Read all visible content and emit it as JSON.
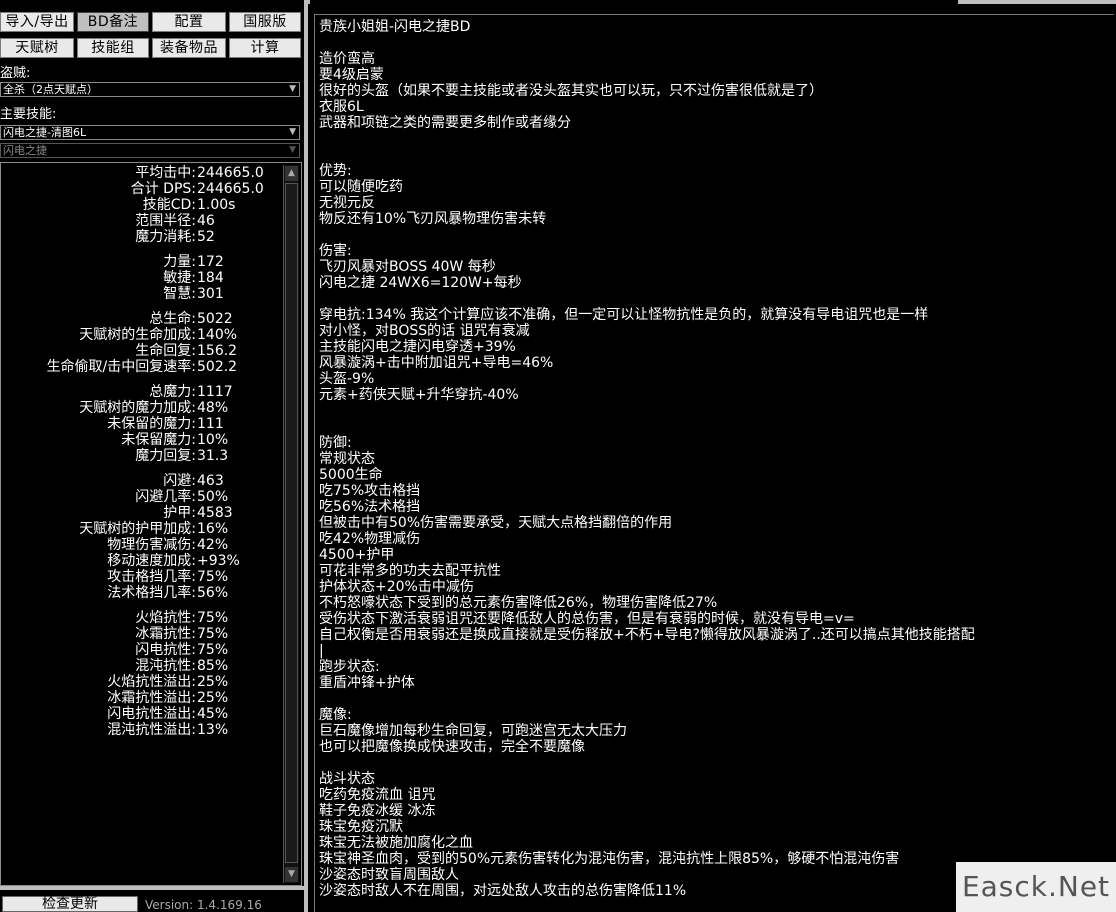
{
  "toolbar": {
    "row1": [
      "导入/导出",
      "BD备注",
      "配置",
      "国服版"
    ],
    "row2": [
      "天赋树",
      "技能组",
      "装备物品",
      "计算"
    ]
  },
  "class_label": "盗贼:",
  "class_select": "全杀（2点天赋点）",
  "skill_label": "主要技能:",
  "skill_select": "闪电之捷-清图6L",
  "sub_skill_select": "闪电之捷",
  "stats": [
    {
      "k": "平均击中:",
      "v": "244665.0"
    },
    {
      "k": "合计 DPS:",
      "v": "244665.0"
    },
    {
      "k": "技能CD:",
      "v": "1.00s"
    },
    {
      "k": "范围半径:",
      "v": "46"
    },
    {
      "k": "魔力消耗:",
      "v": "52"
    },
    {
      "k": "力量:",
      "v": "172"
    },
    {
      "k": "敏捷:",
      "v": "184"
    },
    {
      "k": "智慧:",
      "v": "301"
    },
    {
      "k": "总生命:",
      "v": "5022"
    },
    {
      "k": "天赋树的生命加成:",
      "v": "140%"
    },
    {
      "k": "生命回复:",
      "v": "156.2"
    },
    {
      "k": "生命偷取/击中回复速率:",
      "v": "502.2"
    },
    {
      "k": "总魔力:",
      "v": "1117"
    },
    {
      "k": "天赋树的魔力加成:",
      "v": "48%"
    },
    {
      "k": "未保留的魔力:",
      "v": "111"
    },
    {
      "k": "未保留魔力:",
      "v": "10%"
    },
    {
      "k": "魔力回复:",
      "v": "31.3"
    },
    {
      "k": "闪避:",
      "v": "463"
    },
    {
      "k": "闪避几率:",
      "v": "50%"
    },
    {
      "k": "护甲:",
      "v": "4583"
    },
    {
      "k": "天赋树的护甲加成:",
      "v": "16%"
    },
    {
      "k": "物理伤害减伤:",
      "v": "42%"
    },
    {
      "k": "移动速度加成:",
      "v": "+93%"
    },
    {
      "k": "攻击格挡几率:",
      "v": "75%"
    },
    {
      "k": "法术格挡几率:",
      "v": "56%"
    },
    {
      "k": "火焰抗性:",
      "v": "75%"
    },
    {
      "k": "冰霜抗性:",
      "v": "75%"
    },
    {
      "k": "闪电抗性:",
      "v": "75%"
    },
    {
      "k": "混沌抗性:",
      "v": "85%"
    },
    {
      "k": "火焰抗性溢出:",
      "v": "25%"
    },
    {
      "k": "冰霜抗性溢出:",
      "v": "25%"
    },
    {
      "k": "闪电抗性溢出:",
      "v": "45%"
    },
    {
      "k": "混沌抗性溢出:",
      "v": "13%"
    }
  ],
  "update_button": "检查更新",
  "version": "Version: 1.4.169.16",
  "notes": "贵族小姐姐-闪电之捷BD\n\n造价蛮高\n要4级启蒙\n很好的头盔（如果不要主技能或者没头盔其实也可以玩，只不过伤害很低就是了）\n衣服6L\n武器和项链之类的需要更多制作或者缘分\n\n\n优势:\n可以随便吃药\n无视元反\n物反还有10%飞刃风暴物理伤害未转\n\n伤害:\n飞刃风暴对BOSS 40W 每秒\n闪电之捷 24WX6=120W+每秒\n\n穿电抗:134% 我这个计算应该不准确，但一定可以让怪物抗性是负的，就算没有导电诅咒也是一样\n对小怪，对BOSS的话 诅咒有衰减\n主技能闪电之捷闪电穿透+39%\n风暴漩涡+击中附加诅咒+导电=46%\n头盔-9%\n元素+药侠天赋+升华穿抗-40%\n\n\n防御:\n常规状态\n5000生命\n吃75%攻击格挡\n吃56%法术格挡\n但被击中有50%伤害需要承受，天赋大点格挡翻倍的作用\n吃42%物理减伤\n4500+护甲\n可花非常多的功夫去配平抗性\n护体状态+20%击中减伤\n不朽怒嚎状态下受到的总元素伤害降低26%，物理伤害降低27%\n受伤状态下激活衰弱诅咒还要降低敌人的总伤害，但是有衰弱的时候，就没有导电=v=\n自己权衡是否用衰弱还是换成直接就是受伤释放+不朽+导电?懒得放风暴漩涡了..还可以搞点其他技能搭配\n|\n跑步状态:\n重盾冲锋+护体\n\n魔像:\n巨石魔像增加每秒生命回复，可跑迷宫无太大压力\n也可以把魔像换成快速攻击，完全不要魔像\n\n战斗状态\n吃药免疫流血 诅咒\n鞋子免疫冰缓 冰冻\n珠宝免疫沉默\n珠宝无法被施加腐化之血\n珠宝神圣血肉，受到的50%元素伤害转化为混沌伤害，混沌抗性上限85%，够硬不怕混沌伤害\n沙姿态时致盲周围敌人\n沙姿态时敌人不在周围，对远处敌人攻击的总伤害降低11%",
  "watermark": "Easck.Net"
}
